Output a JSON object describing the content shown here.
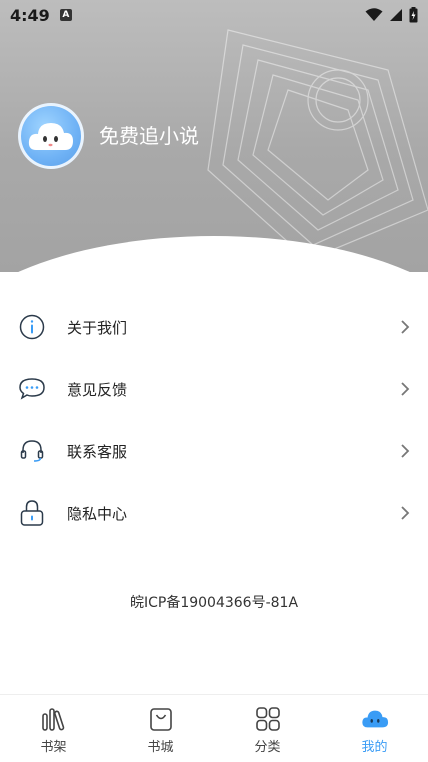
{
  "status": {
    "time": "4:49",
    "notification_letter": "A"
  },
  "profile": {
    "username": "免费追小说"
  },
  "menu": {
    "items": [
      {
        "label": "关于我们",
        "icon": "info-icon"
      },
      {
        "label": "意见反馈",
        "icon": "chat-icon"
      },
      {
        "label": "联系客服",
        "icon": "headset-icon"
      },
      {
        "label": "隐私中心",
        "icon": "lock-icon"
      }
    ]
  },
  "footer": {
    "icp": "皖ICP备19004366号-81A"
  },
  "tabbar": {
    "tabs": [
      {
        "label": "书架",
        "icon": "bookshelf-icon",
        "active": false
      },
      {
        "label": "书城",
        "icon": "shopping-bag-icon",
        "active": false
      },
      {
        "label": "分类",
        "icon": "grid-icon",
        "active": false
      },
      {
        "label": "我的",
        "icon": "cloud-icon",
        "active": true
      }
    ]
  },
  "colors": {
    "accent": "#3a9cf5",
    "header_gray": "#a9a9a9"
  }
}
